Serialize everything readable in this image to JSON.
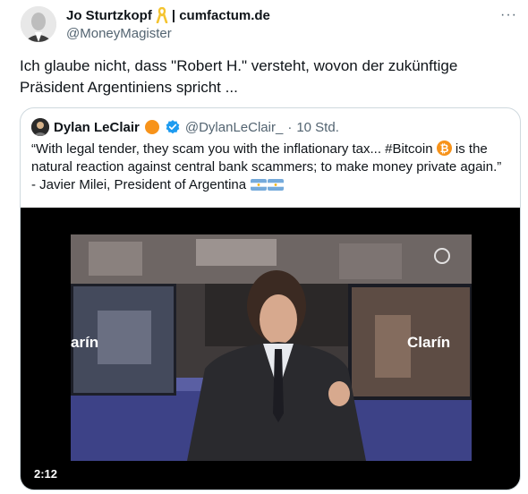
{
  "tweet": {
    "author_name": "Jo Sturtzkopf",
    "author_suffix": "| cumfactum.de",
    "handle": "@MoneyMagister",
    "text": "Ich glaube nicht, dass \"Robert H.\" versteht, wovon der zukünftige Präsident Argentiniens spricht ...",
    "more_icon": "more-horizontal-icon"
  },
  "quote": {
    "author_name": "Dylan LeClair",
    "handle": "@DylanLeClair_",
    "separator": "·",
    "time": "10 Std.",
    "text_part1": "“With legal tender, they scam you with the inflationary tax... #Bitcoin",
    "text_part2": " is the natural reaction against central bank scammers; to make money private again.”  - Javier Milei, President of Argentina ",
    "video": {
      "duration": "2:12",
      "watermark_left": "arín",
      "watermark_right": "Clarín"
    }
  },
  "colors": {
    "text": "#0f1419",
    "secondary": "#536471",
    "verified": "#1d9bf0",
    "border": "#cfd9de",
    "badge_orange": "#f7931a"
  }
}
